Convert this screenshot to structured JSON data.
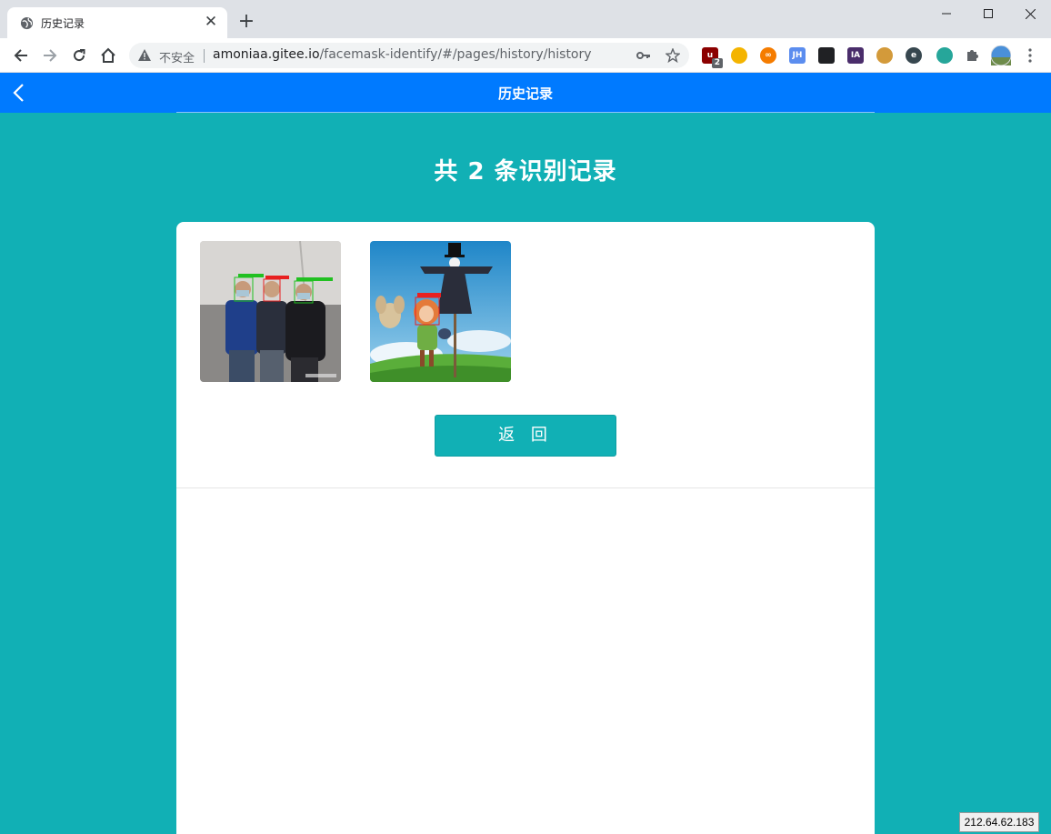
{
  "browser": {
    "tab_title": "历史记录",
    "security_label": "不安全",
    "url_host": "amoniaa.gitee.io",
    "url_path": "/facemask-identify/#/pages/history/history",
    "extensions": [
      {
        "name": "ublock",
        "label": "",
        "color": "#8b0000",
        "badge": "2"
      },
      {
        "name": "ext-2",
        "label": "",
        "color": "#f4b400"
      },
      {
        "name": "ext-3",
        "label": "∞",
        "color": "#f57c00"
      },
      {
        "name": "jh",
        "label": "JH",
        "color": "#5b8def"
      },
      {
        "name": "ext-5",
        "label": "",
        "color": "#202124"
      },
      {
        "name": "ia",
        "label": "IA",
        "color": "#4a2d6b"
      },
      {
        "name": "ext-7",
        "label": "",
        "color": "#d39a3a"
      },
      {
        "name": "ext-8",
        "label": "e",
        "color": "#37474f"
      },
      {
        "name": "ext-9",
        "label": "",
        "color": "#26a69a"
      }
    ]
  },
  "page": {
    "nav_title": "历史记录",
    "headline": "共 2 条识别记录",
    "back_button": "返 回",
    "records": [
      {
        "id": "record-1",
        "desc": "three people with masks"
      },
      {
        "id": "record-2",
        "desc": "anime scene"
      }
    ]
  },
  "overlay": {
    "ip": "212.64.62.183"
  }
}
